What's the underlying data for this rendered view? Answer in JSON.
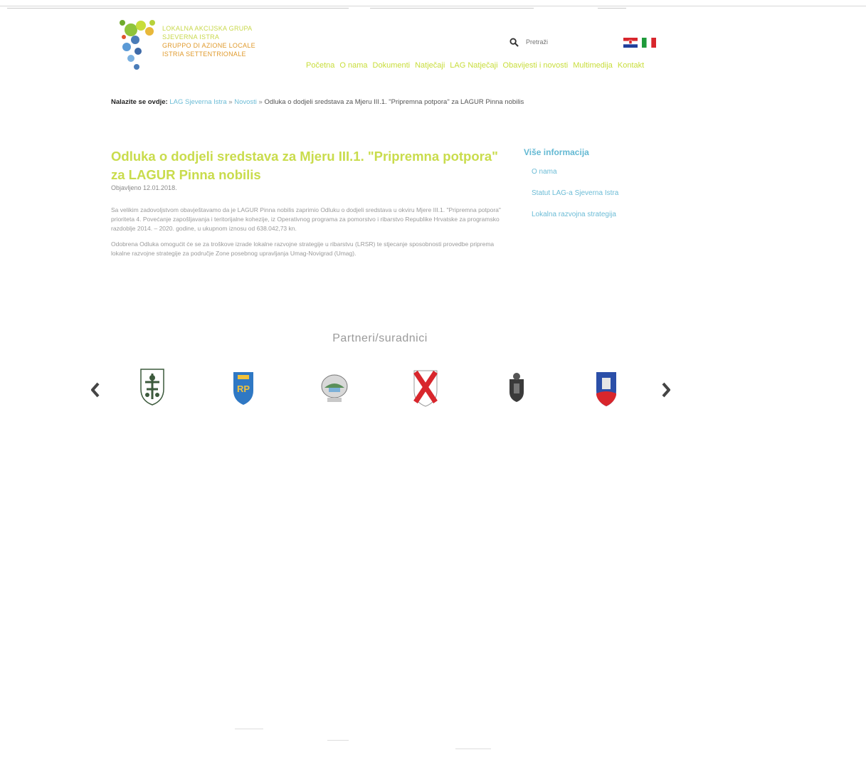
{
  "header": {
    "logo_lines": [
      "LOKALNA AKCIJSKA GRUPA",
      "SJEVERNA ISTRA",
      "GRUPPO DI AZIONE LOCALE",
      "ISTRIA SETTENTRIONALE"
    ],
    "search_placeholder": "Pretraži",
    "languages": [
      {
        "code": "hr",
        "name": "Hrvatski",
        "icon": "croatian-flag-icon"
      },
      {
        "code": "it",
        "name": "Italiano",
        "icon": "italian-flag-icon"
      }
    ],
    "nav": [
      "Početna",
      "O nama",
      "Dokumenti",
      "Natječaji",
      "LAG Natječaji",
      "Obavijesti i novosti",
      "Multimedija",
      "Kontakt"
    ]
  },
  "breadcrumb": {
    "label": "Nalazite se ovdje:",
    "items": [
      "LAG Sjeverna Istra",
      "Novosti",
      "Odluka o dodjeli sredstava za Mjeru III.1. \"Pripremna potpora\" za LAGUR Pinna nobilis"
    ],
    "separator": "»"
  },
  "article": {
    "title": "Odluka o dodjeli sredstava za Mjeru III.1. \"Pripremna potpora\" za LAGUR Pinna nobilis",
    "date": "Objavljeno 12.01.2018.",
    "paragraphs": [
      "Sa velikim zadovoljstvom obavještavamo da je LAGUR Pinna nobilis zaprimio Odluku o dodjeli sredstava u okviru Mjere III.1. \"Pripremna potpora\" prioriteta 4. Povećanje zapošljavanja i teritorijalne kohezije, iz Operativnog programa za pomorstvo i ribarstvo Republike Hrvatske za programsko razdoblje 2014. – 2020. godine, u ukupnom iznosu od 638.042,73 kn.",
      "Odobrena Odluka omogućit će se za troškove izrade lokalne razvojne strategije u ribarstvu (LRSR) te stjecanje sposobnosti provedbe priprema lokalne razvojne strategije za područje Zone posebnog upravljanja Umag-Novigrad (Umag)."
    ]
  },
  "sidebar": {
    "title": "Više informacija",
    "links": [
      "O nama",
      "Statut LAG-a Sjeverna Istra",
      "Lokalna razvojna strategija"
    ]
  },
  "partners": {
    "title": "Partneri/suradnici",
    "logos": [
      {
        "name": "buje-crest-icon",
        "colors": [
          "#ffffff",
          "#3c5a3c"
        ]
      },
      {
        "name": "umag-crest-icon",
        "colors": [
          "#2f78c4",
          "#f2c23a"
        ]
      },
      {
        "name": "novigrad-crest-icon",
        "colors": [
          "#5a8f5a",
          "#c8c8c8"
        ]
      },
      {
        "name": "brtonigla-crest-icon",
        "colors": [
          "#ffffff",
          "#d8262c"
        ]
      },
      {
        "name": "groznjan-crest-icon",
        "colors": [
          "#3a3a3a",
          "#777777"
        ]
      },
      {
        "name": "oprtalj-crest-icon",
        "colors": [
          "#2b4fa8",
          "#d8262c"
        ]
      }
    ]
  },
  "colors": {
    "brand_green": "#c8dd3a",
    "link_blue": "#6cbcd6",
    "accent_orange": "#e09a2c"
  }
}
